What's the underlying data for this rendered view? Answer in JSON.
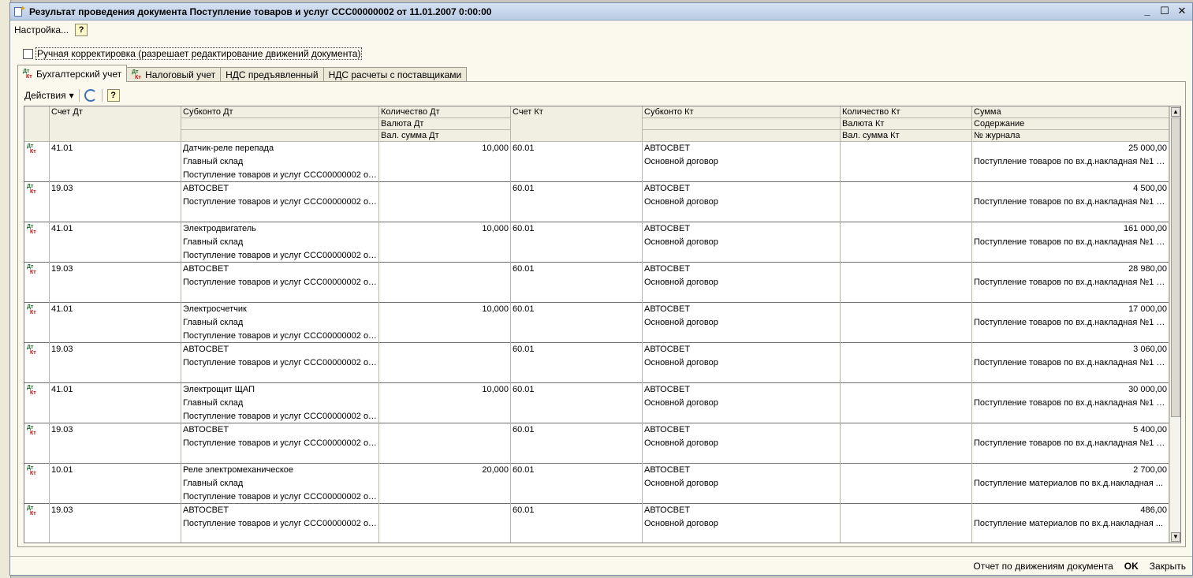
{
  "window": {
    "title": "Результат проведения документа Поступление товаров и услуг ССС00000002 от 11.01.2007 0:00:00",
    "controls": [
      "_",
      "☐",
      "✕"
    ]
  },
  "menu": {
    "settings_label": "Настройка...",
    "help_label": "?"
  },
  "manual_correction": {
    "label": "Ручная корректировка (разрешает редактирование движений документа)",
    "checked": false
  },
  "tabs": [
    {
      "label": "Бухгалтерский учет",
      "icon": "dt-kt-icon",
      "active": true
    },
    {
      "label": "Налоговый учет",
      "icon": "dt-kt-tax-icon",
      "active": false
    },
    {
      "label": "НДС предъявленный",
      "active": false
    },
    {
      "label": "НДС расчеты с поставщиками",
      "active": false
    }
  ],
  "toolbar": {
    "actions_label": "Действия",
    "help_label": "?"
  },
  "icon_text": {
    "dt": "Дт",
    "kt": "Кт"
  },
  "columns": {
    "dt_account": "Счет Дт",
    "dt_subconto": "Субконто Дт",
    "dt_qty": "Количество Дт",
    "dt_currency": "Валюта Дт",
    "dt_cur_sum": "Вал. сумма Дт",
    "kt_account": "Счет Кт",
    "kt_subconto": "Субконто Кт",
    "kt_qty": "Количество Кт",
    "kt_currency": "Валюта Кт",
    "kt_cur_sum": "Вал. сумма Кт",
    "sum": "Сумма",
    "content": "Содержание",
    "journal": "№ журнала"
  },
  "rows": [
    {
      "dt": "41.01",
      "dt_sub": [
        "Датчик-реле перепада",
        "Главный склад",
        "Поступление товаров и услуг ССС00000002 от ..."
      ],
      "dt_qty": "10,000",
      "kt": "60.01",
      "kt_sub": [
        "АВТОСВЕТ",
        "Основной договор"
      ],
      "sum": "25 000,00",
      "content": "Поступление товаров по вх.д.накладная №1 о..."
    },
    {
      "dt": "19.03",
      "dt_sub": [
        "АВТОСВЕТ",
        "Поступление товаров и услуг ССС00000002 от ..."
      ],
      "dt_qty": "",
      "kt": "60.01",
      "kt_sub": [
        "АВТОСВЕТ",
        "Основной договор"
      ],
      "sum": "4 500,00",
      "content": "Поступление товаров по вх.д.накладная №1 о..."
    },
    {
      "dt": "41.01",
      "dt_sub": [
        "Электродвигатель",
        "Главный склад",
        "Поступление товаров и услуг ССС00000002 от ..."
      ],
      "dt_qty": "10,000",
      "kt": "60.01",
      "kt_sub": [
        "АВТОСВЕТ",
        "Основной договор"
      ],
      "sum": "161 000,00",
      "content": "Поступление товаров по вх.д.накладная №1 о..."
    },
    {
      "dt": "19.03",
      "dt_sub": [
        "АВТОСВЕТ",
        "Поступление товаров и услуг ССС00000002 от ..."
      ],
      "dt_qty": "",
      "kt": "60.01",
      "kt_sub": [
        "АВТОСВЕТ",
        "Основной договор"
      ],
      "sum": "28 980,00",
      "content": "Поступление товаров по вх.д.накладная №1 о..."
    },
    {
      "dt": "41.01",
      "dt_sub": [
        "Электросчетчик",
        "Главный склад",
        "Поступление товаров и услуг ССС00000002 от ..."
      ],
      "dt_qty": "10,000",
      "kt": "60.01",
      "kt_sub": [
        "АВТОСВЕТ",
        "Основной договор"
      ],
      "sum": "17 000,00",
      "content": "Поступление товаров по вх.д.накладная №1 о..."
    },
    {
      "dt": "19.03",
      "dt_sub": [
        "АВТОСВЕТ",
        "Поступление товаров и услуг ССС00000002 от ..."
      ],
      "dt_qty": "",
      "kt": "60.01",
      "kt_sub": [
        "АВТОСВЕТ",
        "Основной договор"
      ],
      "sum": "3 060,00",
      "content": "Поступление товаров по вх.д.накладная №1 о..."
    },
    {
      "dt": "41.01",
      "dt_sub": [
        "Электрощит ЩАП",
        "Главный склад",
        "Поступление товаров и услуг ССС00000002 от ..."
      ],
      "dt_qty": "10,000",
      "kt": "60.01",
      "kt_sub": [
        "АВТОСВЕТ",
        "Основной договор"
      ],
      "sum": "30 000,00",
      "content": "Поступление товаров по вх.д.накладная №1 о..."
    },
    {
      "dt": "19.03",
      "dt_sub": [
        "АВТОСВЕТ",
        "Поступление товаров и услуг ССС00000002 от ..."
      ],
      "dt_qty": "",
      "kt": "60.01",
      "kt_sub": [
        "АВТОСВЕТ",
        "Основной договор"
      ],
      "sum": "5 400,00",
      "content": "Поступление товаров по вх.д.накладная №1 о..."
    },
    {
      "dt": "10.01",
      "dt_sub": [
        "Реле электромеханическое",
        "Главный склад",
        "Поступление товаров и услуг ССС00000002 от ..."
      ],
      "dt_qty": "20,000",
      "kt": "60.01",
      "kt_sub": [
        "АВТОСВЕТ",
        "Основной договор"
      ],
      "sum": "2 700,00",
      "content": "Поступление материалов по вх.д.накладная ..."
    },
    {
      "dt": "19.03",
      "dt_sub": [
        "АВТОСВЕТ",
        "Поступление товаров и услуг ССС00000002 от ..."
      ],
      "dt_qty": "",
      "kt": "60.01",
      "kt_sub": [
        "АВТОСВЕТ",
        "Основной договор"
      ],
      "sum": "486,00",
      "content": "Поступление материалов по вх.д.накладная ..."
    }
  ],
  "footer": {
    "report_label": "Отчет по движениям документа",
    "ok_label": "OK",
    "close_label": "Закрыть"
  }
}
